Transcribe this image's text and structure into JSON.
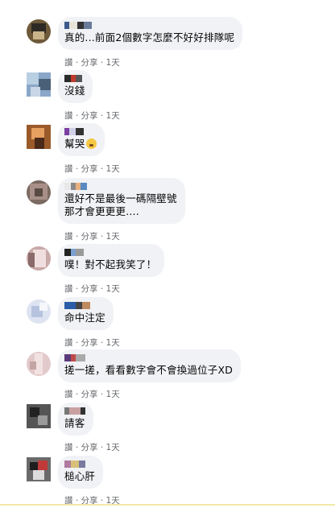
{
  "action_labels": {
    "like": "讚",
    "reply": "分享",
    "time": "1天",
    "sep": " · "
  },
  "comments": [
    {
      "text": "真的...前面2個數字怎麼不好好排隊呢"
    },
    {
      "text": "沒錢"
    },
    {
      "text": "幫哭",
      "emoji": "crying-face-icon"
    },
    {
      "text": "還好不是最後一碼隔壁號",
      "text2": "那才會更更更...."
    },
    {
      "text": "噗！對不起我笑了！"
    },
    {
      "text": "命中注定"
    },
    {
      "text": "搓一搓，看看數字會不會換過位子XD"
    },
    {
      "text": "請客"
    },
    {
      "text": "槌心肝"
    }
  ]
}
